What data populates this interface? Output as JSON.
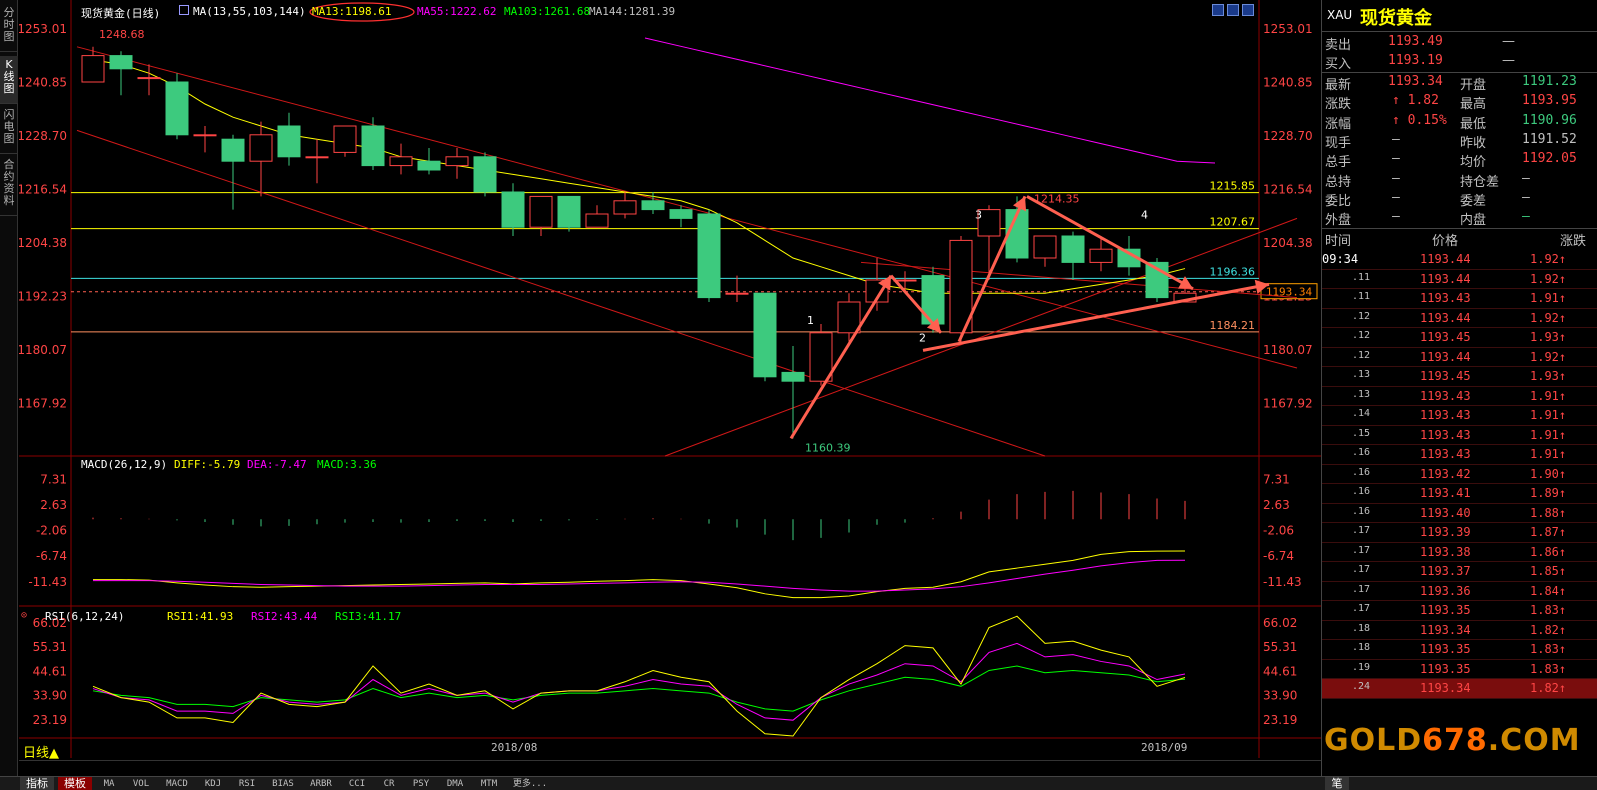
{
  "colors": {
    "up": "#ff4545",
    "down": "#3dca7e",
    "bg": "#000000",
    "ma13": "#ffff00",
    "ma55": "#ff00ff",
    "ma103": "#00ff00",
    "ma144": "#c0c0c0",
    "diff": "#ffff00",
    "dea": "#ff00ff",
    "rsi1": "#ffff00",
    "rsi2": "#ff00ff",
    "rsi3": "#00ff00",
    "arrow": "#ff6050"
  },
  "side_tabs": [
    {
      "label": "分时图",
      "icon": "time-share-icon"
    },
    {
      "label": "K线图",
      "icon": "kline-icon"
    },
    {
      "label": "闪电图",
      "icon": "flash-chart-icon"
    },
    {
      "label": "合约资料",
      "icon": "contract-info-icon"
    }
  ],
  "header": {
    "title": "现货黄金(日线)",
    "ma_label": "MA(13,55,103,144)",
    "ma13": "MA13:1198.61",
    "ma55": "MA55:1222.62",
    "ma103": "MA103:1261.68",
    "ma144": "MA144:1281.39"
  },
  "window_icons": [
    "restore-icon",
    "scroll-icon",
    "settings-icon"
  ],
  "price_axis": [
    "1253.01",
    "1240.85",
    "1228.70",
    "1216.54",
    "1204.38",
    "1192.23",
    "1180.07",
    "1167.92"
  ],
  "annotations": {
    "high_label": "1248.68",
    "low_label": "1160.39",
    "recent_high": "1214.35",
    "levels": [
      {
        "value": "1215.85",
        "color": "#ffff00"
      },
      {
        "value": "1207.67",
        "color": "#ffff00"
      },
      {
        "value": "1196.36",
        "color": "#3ee0e0"
      },
      {
        "value": "1184.21",
        "color": "#ff9060"
      }
    ],
    "current_price": "1193.34",
    "wave_labels": [
      "1",
      "2",
      "3",
      "4"
    ]
  },
  "macd": {
    "label": "MACD(26,12,9)",
    "diff": "DIFF:-5.79",
    "dea": "DEA:-7.47",
    "macd": "MACD:3.36",
    "axis": [
      "7.31",
      "2.63",
      "-2.06",
      "-6.74",
      "-11.43"
    ]
  },
  "rsi": {
    "label": "RSI(6,12,24)",
    "rsi1": "RSI1:41.93",
    "rsi2": "RSI2:43.44",
    "rsi3": "RSI3:41.17",
    "axis": [
      "66.02",
      "55.31",
      "44.61",
      "33.90",
      "23.19"
    ]
  },
  "date_labels": [
    "2018/08",
    "2018/09"
  ],
  "period_button": "日线▲",
  "tabs": [
    "指标",
    "模板",
    "MA",
    "VOL",
    "MACD",
    "KDJ",
    "RSI",
    "BIAS",
    "ARBR",
    "CCI",
    "CR",
    "PSY",
    "DMA",
    "MTM",
    "更多..."
  ],
  "panel": {
    "code": "XAU",
    "name": "现货黄金",
    "sell": {
      "label": "卖出",
      "value": "1193.49",
      "vol": "—"
    },
    "buy": {
      "label": "买入",
      "value": "1193.19",
      "vol": "—"
    },
    "stats_left": [
      {
        "label": "最新",
        "value": "1193.34"
      },
      {
        "label": "涨跌",
        "value": "↑ 1.82"
      },
      {
        "label": "涨幅",
        "value": "↑ 0.15%"
      },
      {
        "label": "现手",
        "value": "—"
      },
      {
        "label": "总手",
        "value": "—"
      },
      {
        "label": "总持",
        "value": "—"
      },
      {
        "label": "委比",
        "value": "—"
      },
      {
        "label": "外盘",
        "value": "—"
      }
    ],
    "stats_right": [
      {
        "label": "开盘",
        "value": "1191.23",
        "color": "#3dca7e"
      },
      {
        "label": "最高",
        "value": "1193.95",
        "color": "#ff4545"
      },
      {
        "label": "最低",
        "value": "1190.96",
        "color": "#3dca7e"
      },
      {
        "label": "昨收",
        "value": "1191.52",
        "color": "#c0c0c0"
      },
      {
        "label": "均价",
        "value": "1192.05",
        "color": "#ff4545"
      },
      {
        "label": "持仓差",
        "value": "—",
        "color": "#c0c0c0"
      },
      {
        "label": "委差",
        "value": "—",
        "color": "#c0c0c0"
      },
      {
        "label": "内盘",
        "value": "—",
        "color": "#3dca7e"
      }
    ],
    "tick_header": {
      "time": "时间",
      "price": "价格",
      "change": "涨跌"
    },
    "ticks": [
      {
        "time": "09:34",
        "price": "1193.44",
        "change": "1.92↑"
      },
      {
        "time": ".11",
        "price": "1193.44",
        "change": "1.92↑"
      },
      {
        "time": ".11",
        "price": "1193.43",
        "change": "1.91↑"
      },
      {
        "time": ".12",
        "price": "1193.44",
        "change": "1.92↑"
      },
      {
        "time": ".12",
        "price": "1193.45",
        "change": "1.93↑"
      },
      {
        "time": ".12",
        "price": "1193.44",
        "change": "1.92↑"
      },
      {
        "time": ".13",
        "price": "1193.45",
        "change": "1.93↑"
      },
      {
        "time": ".13",
        "price": "1193.43",
        "change": "1.91↑"
      },
      {
        "time": ".14",
        "price": "1193.43",
        "change": "1.91↑"
      },
      {
        "time": ".15",
        "price": "1193.43",
        "change": "1.91↑"
      },
      {
        "time": ".16",
        "price": "1193.43",
        "change": "1.91↑"
      },
      {
        "time": ".16",
        "price": "1193.42",
        "change": "1.90↑"
      },
      {
        "time": ".16",
        "price": "1193.41",
        "change": "1.89↑"
      },
      {
        "time": ".16",
        "price": "1193.40",
        "change": "1.88↑"
      },
      {
        "time": ".17",
        "price": "1193.39",
        "change": "1.87↑"
      },
      {
        "time": ".17",
        "price": "1193.38",
        "change": "1.86↑"
      },
      {
        "time": ".17",
        "price": "1193.37",
        "change": "1.85↑"
      },
      {
        "time": ".17",
        "price": "1193.36",
        "change": "1.84↑"
      },
      {
        "time": ".17",
        "price": "1193.35",
        "change": "1.83↑"
      },
      {
        "time": ".18",
        "price": "1193.34",
        "change": "1.82↑"
      },
      {
        "time": ".18",
        "price": "1193.35",
        "change": "1.83↑"
      },
      {
        "time": ".19",
        "price": "1193.35",
        "change": "1.83↑"
      },
      {
        "time": ".24",
        "price": "1193.34",
        "change": "1.82↑"
      }
    ],
    "watermark_a": "GOLD",
    "watermark_b": "678",
    "watermark_c": ".COM",
    "bottom_tab": "笔"
  },
  "chart_data": [
    {
      "type": "candlestick",
      "title": "现货黄金(日线)",
      "ylim": [
        1156,
        1256
      ],
      "candles": [
        {
          "o": 1241,
          "h": 1249,
          "c": 1247,
          "l": 1241
        },
        {
          "o": 1247,
          "h": 1248,
          "c": 1244,
          "l": 1238
        },
        {
          "o": 1242,
          "h": 1245,
          "c": 1242,
          "l": 1238
        },
        {
          "o": 1241,
          "h": 1243,
          "c": 1229,
          "l": 1228
        },
        {
          "o": 1229,
          "h": 1231,
          "c": 1229,
          "l": 1225
        },
        {
          "o": 1228,
          "h": 1229,
          "c": 1223,
          "l": 1212
        },
        {
          "o": 1223,
          "h": 1232,
          "c": 1229,
          "l": 1215
        },
        {
          "o": 1231,
          "h": 1234,
          "c": 1224,
          "l": 1222
        },
        {
          "o": 1224,
          "h": 1228,
          "c": 1224,
          "l": 1218
        },
        {
          "o": 1225,
          "h": 1231,
          "c": 1231,
          "l": 1224
        },
        {
          "o": 1231,
          "h": 1233,
          "c": 1222,
          "l": 1221
        },
        {
          "o": 1222,
          "h": 1227,
          "c": 1224,
          "l": 1220
        },
        {
          "o": 1223,
          "h": 1226,
          "c": 1221,
          "l": 1220
        },
        {
          "o": 1222,
          "h": 1226,
          "c": 1224,
          "l": 1219
        },
        {
          "o": 1224,
          "h": 1225,
          "c": 1216,
          "l": 1215
        },
        {
          "o": 1216,
          "h": 1218,
          "c": 1208,
          "l": 1206
        },
        {
          "o": 1208,
          "h": 1215,
          "c": 1215,
          "l": 1206
        },
        {
          "o": 1215,
          "h": 1215,
          "c": 1208,
          "l": 1207
        },
        {
          "o": 1208,
          "h": 1213,
          "c": 1211,
          "l": 1208
        },
        {
          "o": 1211,
          "h": 1216,
          "c": 1214,
          "l": 1210
        },
        {
          "o": 1214,
          "h": 1216,
          "c": 1212,
          "l": 1211
        },
        {
          "o": 1212,
          "h": 1213,
          "c": 1210,
          "l": 1208
        },
        {
          "o": 1211,
          "h": 1212,
          "c": 1192,
          "l": 1191
        },
        {
          "o": 1193,
          "h": 1197,
          "c": 1193,
          "l": 1191
        },
        {
          "o": 1193,
          "h": 1193,
          "c": 1174,
          "l": 1173
        },
        {
          "o": 1175,
          "h": 1181,
          "c": 1173,
          "l": 1160
        },
        {
          "o": 1173,
          "h": 1186,
          "c": 1184,
          "l": 1172
        },
        {
          "o": 1184,
          "h": 1193,
          "c": 1191,
          "l": 1182
        },
        {
          "o": 1191,
          "h": 1201,
          "c": 1196,
          "l": 1189
        },
        {
          "o": 1196,
          "h": 1198,
          "c": 1196,
          "l": 1193
        },
        {
          "o": 1197,
          "h": 1199,
          "c": 1186,
          "l": 1184
        },
        {
          "o": 1184,
          "h": 1206,
          "c": 1205,
          "l": 1182
        },
        {
          "o": 1206,
          "h": 1213,
          "c": 1212,
          "l": 1196
        },
        {
          "o": 1212,
          "h": 1215,
          "c": 1201,
          "l": 1200
        },
        {
          "o": 1201,
          "h": 1206,
          "c": 1206,
          "l": 1199
        },
        {
          "o": 1206,
          "h": 1207,
          "c": 1200,
          "l": 1196
        },
        {
          "o": 1200,
          "h": 1206,
          "c": 1203,
          "l": 1198
        },
        {
          "o": 1203,
          "h": 1206,
          "c": 1199,
          "l": 1197
        },
        {
          "o": 1200,
          "h": 1201,
          "c": 1192,
          "l": 1191
        },
        {
          "o": 1191,
          "h": 1194,
          "c": 1193,
          "l": 1191
        }
      ],
      "ma13": [
        1246,
        1245,
        1243,
        1240,
        1236,
        1233,
        1231,
        1229,
        1228,
        1227,
        1226,
        1224,
        1223,
        1222,
        1221,
        1220,
        1219,
        1218,
        1217,
        1216,
        1215,
        1214,
        1212,
        1209,
        1205,
        1201,
        1199,
        1197,
        1195,
        1194,
        1193,
        1193,
        1193,
        1193,
        1193,
        1194,
        1195,
        1196,
        1197,
        1198.6
      ],
      "ma55_partial": [
        1251,
        1249,
        1247,
        1245,
        1243,
        1241,
        1239,
        1237,
        1235,
        1233,
        1231,
        1229,
        1227,
        1225,
        1223,
        1222.6
      ],
      "ma55_start_index": 24
    },
    {
      "type": "bar",
      "title": "MACD(26,12,9)",
      "ylim": [
        -14,
        9
      ],
      "macd": [
        0.3,
        0.2,
        0.1,
        -0.2,
        -0.5,
        -1.0,
        -1.3,
        -1.2,
        -0.9,
        -0.6,
        -0.5,
        -0.6,
        -0.5,
        -0.3,
        -0.3,
        -0.5,
        -0.3,
        -0.2,
        -0.1,
        0.1,
        0.2,
        0.1,
        -0.8,
        -1.5,
        -2.8,
        -3.8,
        -3.4,
        -2.4,
        -1.0,
        -0.6,
        0.2,
        1.4,
        3.6,
        4.6,
        5.0,
        5.2,
        4.9,
        4.6,
        3.8,
        3.36
      ],
      "diff": [
        -11.0,
        -11.0,
        -11.1,
        -11.6,
        -12.0,
        -12.3,
        -12.4,
        -12.3,
        -12.2,
        -12.1,
        -12.0,
        -11.9,
        -11.8,
        -11.7,
        -11.6,
        -11.8,
        -11.6,
        -11.5,
        -11.3,
        -11.2,
        -11.0,
        -11.2,
        -11.8,
        -12.5,
        -13.6,
        -14.3,
        -14.3,
        -14.0,
        -13.2,
        -12.6,
        -12.4,
        -11.4,
        -9.6,
        -8.9,
        -8.2,
        -7.5,
        -6.4,
        -5.9,
        -5.8,
        -5.79
      ],
      "dea": [
        -11.2,
        -11.2,
        -11.2,
        -11.3,
        -11.5,
        -11.7,
        -11.9,
        -12.0,
        -12.1,
        -12.2,
        -12.2,
        -12.2,
        -12.1,
        -12.0,
        -11.9,
        -11.9,
        -11.9,
        -11.8,
        -11.7,
        -11.6,
        -11.5,
        -11.4,
        -11.5,
        -11.8,
        -12.2,
        -12.6,
        -12.9,
        -13.1,
        -13.1,
        -12.9,
        -12.7,
        -12.3,
        -11.6,
        -10.8,
        -10.0,
        -9.3,
        -8.5,
        -7.9,
        -7.5,
        -7.47
      ]
    },
    {
      "type": "line",
      "title": "RSI(6,12,24)",
      "ylim": [
        16,
        70
      ],
      "rsi1": [
        38,
        33,
        31,
        24,
        24,
        22,
        35,
        30,
        29,
        31,
        47,
        35,
        39,
        34,
        36,
        28,
        35,
        36,
        36,
        40,
        45,
        42,
        40,
        27,
        17,
        16,
        33,
        41,
        48,
        56,
        55,
        39,
        64,
        69,
        57,
        58,
        54,
        51,
        38,
        41.93
      ],
      "rsi2": [
        37,
        33,
        32,
        27,
        27,
        26,
        34,
        31,
        30,
        31,
        41,
        34,
        37,
        34,
        35,
        31,
        35,
        36,
        36,
        38,
        41,
        39,
        38,
        30,
        24,
        23,
        33,
        39,
        43,
        48,
        47,
        40,
        53,
        57,
        51,
        52,
        49,
        47,
        41,
        43.44
      ],
      "rsi3": [
        36,
        34,
        33,
        30,
        30,
        29,
        33,
        32,
        31,
        32,
        37,
        33,
        35,
        33,
        34,
        32,
        34,
        35,
        35,
        36,
        37,
        36,
        35,
        31,
        28,
        27,
        32,
        36,
        39,
        42,
        41,
        38,
        45,
        47,
        44,
        45,
        44,
        43,
        40,
        41.17
      ]
    }
  ]
}
